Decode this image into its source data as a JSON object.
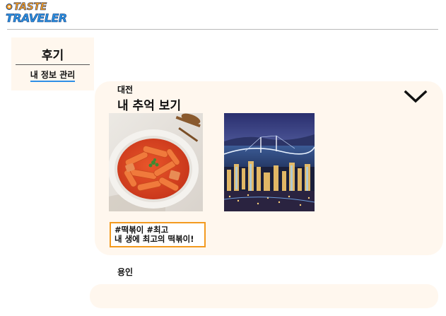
{
  "logo": {
    "line1": "TASTE",
    "line2": "TRAVELER",
    "colors": {
      "orange": "#f39a1f",
      "blue": "#2a8fe0",
      "navy": "#123a7a"
    }
  },
  "sidebar": {
    "title": "후기",
    "link_label": "내 정보 관리"
  },
  "memory_card": {
    "city": "대전",
    "title": "내 추억 보기",
    "toggle_icon": "chevron-down-icon",
    "photos": [
      "tteokbokki-photo",
      "city-night-bridge-photo"
    ],
    "caption": {
      "tags": "#떡볶이 #최고",
      "text": "내 생에 최고의 떡볶이!"
    }
  },
  "second_card": {
    "city": "용인"
  },
  "colors": {
    "card_background": "#fff7ee",
    "accent_orange": "#f39a1f",
    "link_underline": "#2f8fe6"
  }
}
